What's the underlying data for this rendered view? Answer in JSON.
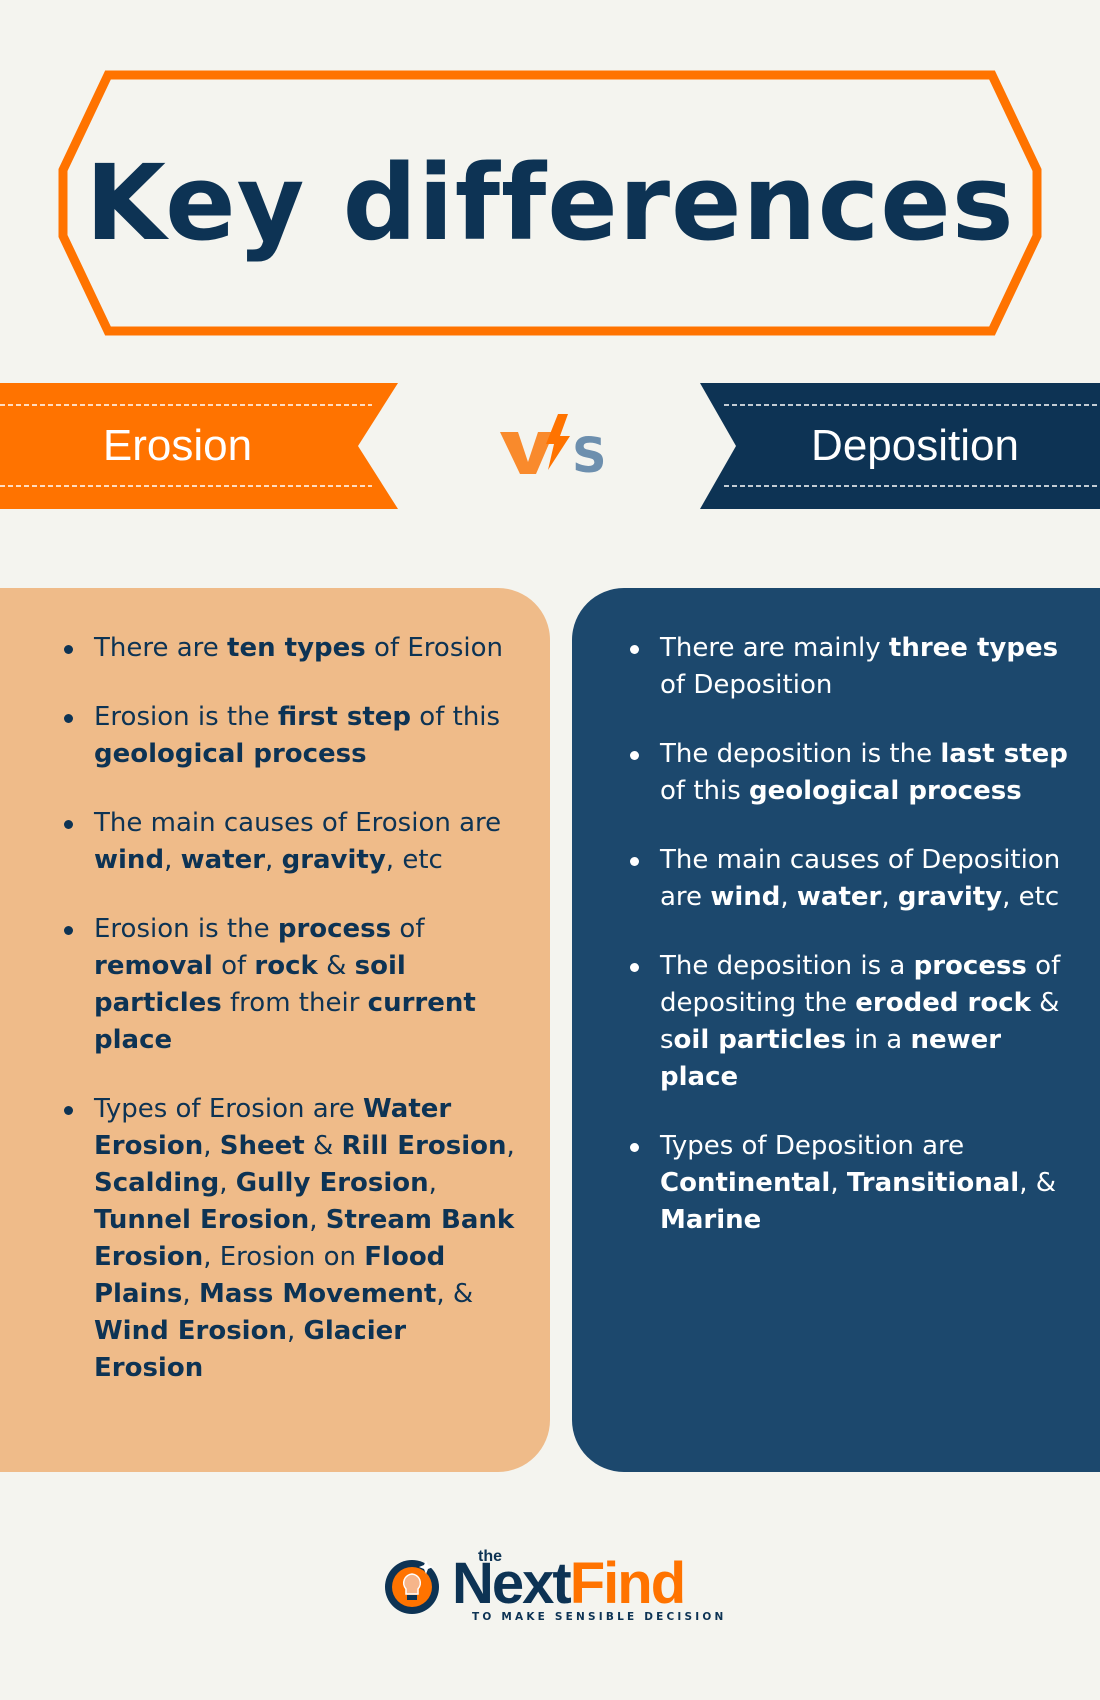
{
  "title": "Key differences",
  "colors": {
    "background": "#f4f4ef",
    "orange": "#ff7300",
    "navy": "#0d3354",
    "left_panel": "#efbb89",
    "right_panel": "#1c486d",
    "vs_s": "#6d8fae"
  },
  "comparison": {
    "left_label": "Erosion",
    "vs_label": "VS",
    "right_label": "Deposition"
  },
  "erosion": {
    "points": [
      [
        {
          "t": "There are "
        },
        {
          "t": "ten types",
          "b": true
        },
        {
          "t": " of Erosion"
        }
      ],
      [
        {
          "t": "Erosion is the "
        },
        {
          "t": "first step",
          "b": true
        },
        {
          "t": " of this "
        },
        {
          "t": "geological process",
          "b": true
        }
      ],
      [
        {
          "t": "The main causes of Erosion are "
        },
        {
          "t": "wind",
          "b": true
        },
        {
          "t": ", "
        },
        {
          "t": "water",
          "b": true
        },
        {
          "t": ", "
        },
        {
          "t": "gravity",
          "b": true
        },
        {
          "t": ", etc"
        }
      ],
      [
        {
          "t": "Erosion is the "
        },
        {
          "t": "process",
          "b": true
        },
        {
          "t": " of "
        },
        {
          "t": "removal",
          "b": true
        },
        {
          "t": " of "
        },
        {
          "t": "rock",
          "b": true
        },
        {
          "t": " & "
        },
        {
          "t": "soil particles",
          "b": true
        },
        {
          "t": " from their "
        },
        {
          "t": "current place",
          "b": true
        }
      ],
      [
        {
          "t": "Types of Erosion are "
        },
        {
          "t": "Water Erosion",
          "b": true
        },
        {
          "t": ", "
        },
        {
          "t": "Sheet",
          "b": true
        },
        {
          "t": " & "
        },
        {
          "t": "Rill Erosion",
          "b": true
        },
        {
          "t": ", "
        },
        {
          "t": "Scalding",
          "b": true
        },
        {
          "t": ", "
        },
        {
          "t": "Gully Erosion",
          "b": true
        },
        {
          "t": ", "
        },
        {
          "t": "Tunnel Erosion",
          "b": true
        },
        {
          "t": ", "
        },
        {
          "t": "Stream Bank Erosion",
          "b": true
        },
        {
          "t": ", Erosion on "
        },
        {
          "t": "Flood Plains",
          "b": true
        },
        {
          "t": ", "
        },
        {
          "t": "Mass Movement",
          "b": true
        },
        {
          "t": ", & "
        },
        {
          "t": "Wind Erosion",
          "b": true
        },
        {
          "t": ", "
        },
        {
          "t": "Glacier Erosion",
          "b": true
        }
      ]
    ]
  },
  "deposition": {
    "points": [
      [
        {
          "t": "There are mainly "
        },
        {
          "t": "three types",
          "b": true
        },
        {
          "t": " of Deposition"
        }
      ],
      [
        {
          "t": "The deposition is the "
        },
        {
          "t": "last step",
          "b": true
        },
        {
          "t": " of this "
        },
        {
          "t": "geological process",
          "b": true
        }
      ],
      [
        {
          "t": "The main causes of Deposition are "
        },
        {
          "t": "wind",
          "b": true
        },
        {
          "t": ", "
        },
        {
          "t": "water",
          "b": true
        },
        {
          "t": ", "
        },
        {
          "t": "gravity",
          "b": true
        },
        {
          "t": ", etc"
        }
      ],
      [
        {
          "t": "The deposition is a "
        },
        {
          "t": "process",
          "b": true
        },
        {
          "t": " of depositing the "
        },
        {
          "t": "eroded rock",
          "b": true
        },
        {
          "t": " & s"
        },
        {
          "t": "oil particles",
          "b": true
        },
        {
          "t": " in a "
        },
        {
          "t": "newer place",
          "b": true
        }
      ],
      [
        {
          "t": "Types of Deposition are "
        },
        {
          "t": "Continental",
          "b": true
        },
        {
          "t": ", "
        },
        {
          "t": "Transitional",
          "b": true
        },
        {
          "t": ", & "
        },
        {
          "t": "Marine",
          "b": true
        }
      ]
    ]
  },
  "logo": {
    "icon": "lightbulb-icon",
    "the": "the",
    "next": "Next",
    "find": "Find",
    "tagline": "TO MAKE SENSIBLE DECISION"
  }
}
